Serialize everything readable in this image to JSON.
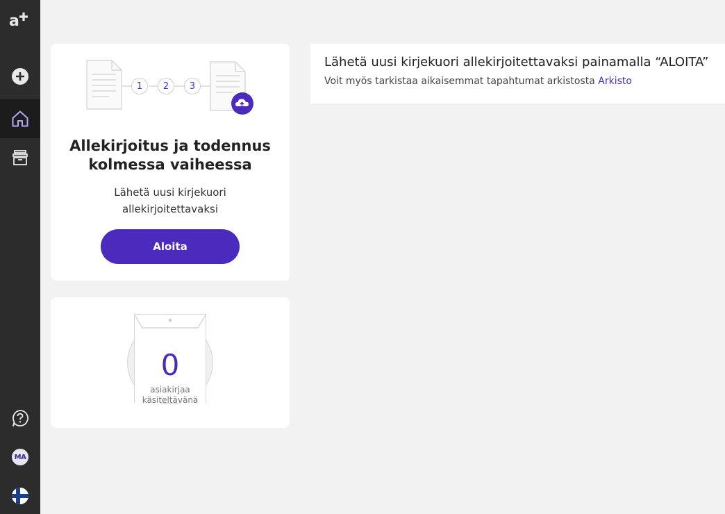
{
  "sidebar": {
    "logo": "a+",
    "items": [
      {
        "icon": "plus-circle-icon"
      },
      {
        "icon": "home-icon"
      },
      {
        "icon": "archive-icon"
      }
    ],
    "bottom": {
      "help_icon": "question-circle-icon",
      "avatar_initials": "MA",
      "language_icon": "finland-flag-icon"
    }
  },
  "steps_card": {
    "steps": [
      "1",
      "2",
      "3"
    ],
    "title_line1": "Allekirjoitus ja todennus",
    "title_line2": "kolmessa vaiheessa",
    "subtitle_line1": "Lähetä uusi kirjekuori",
    "subtitle_line2": "allekirjoitettavaksi",
    "button_label": "Aloita"
  },
  "count_card": {
    "count": "0",
    "label_line1": "asiakirjaa",
    "label_line2": "käsiteltävänä"
  },
  "info": {
    "title": "Lähetä uusi kirjekuori allekirjoitettavaksi painamalla “ALOITA”",
    "text": "Voit myös tarkistaa aikaisemmat tapahtumat arkistosta",
    "link": "Arkisto"
  },
  "colors": {
    "accent": "#4a2bbd",
    "sidebar": "#2c2c2c",
    "background": "#f2f2f2"
  }
}
